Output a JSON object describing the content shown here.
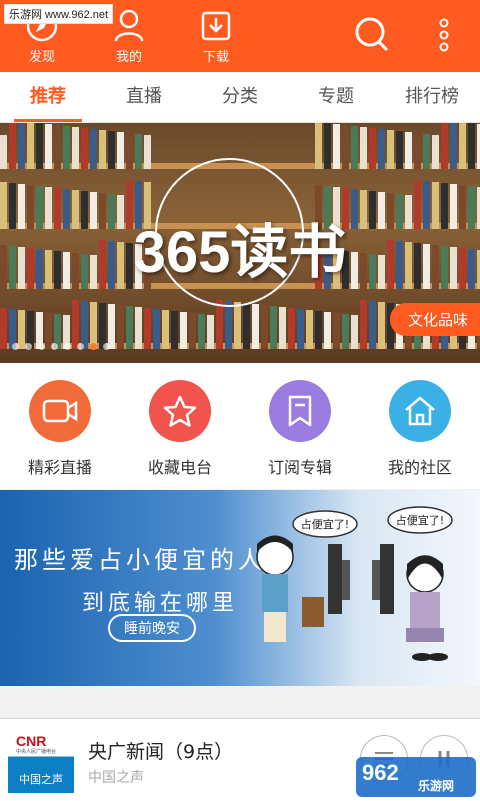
{
  "watermark_top": "乐游网 www.962.net",
  "topbar": {
    "discover_label": "发现",
    "mine_label": "我的",
    "download_label": "下载",
    "icons": [
      "compass-icon",
      "user-icon",
      "download-icon",
      "search-icon",
      "more-vertical-icon"
    ]
  },
  "tabs": [
    {
      "label": "推荐",
      "active": true
    },
    {
      "label": "直播"
    },
    {
      "label": "分类"
    },
    {
      "label": "专题"
    },
    {
      "label": "排行榜"
    }
  ],
  "banner": {
    "title": "365读书",
    "tag": "文化品味",
    "slides": 8,
    "active_slide": 6
  },
  "quick": [
    {
      "label": "精彩直播",
      "color": "#f26b3a",
      "icon": "video-camera-icon"
    },
    {
      "label": "收藏电台",
      "color": "#f0544c",
      "icon": "star-icon"
    },
    {
      "label": "订阅专辑",
      "color": "#9a7be0",
      "icon": "bookmark-icon"
    },
    {
      "label": "我的社区",
      "color": "#3ab0e6",
      "icon": "home-icon"
    }
  ],
  "promo": {
    "line1": "那些爱占小便宜的人，",
    "line2": "到底输在哪里",
    "pill": "睡前晚安",
    "bubble1": "占便宜了!",
    "bubble2": "占便宜了!"
  },
  "player": {
    "cover_logo": "CNR",
    "cover_sub": "中央人民广播电台",
    "cover_channel": "中国之声",
    "title": "央广新闻（9点）",
    "subtitle": "中国之声"
  },
  "watermark_br": {
    "num": "962",
    "site": "乐游网"
  },
  "colors": {
    "accent": "#ff5a1f"
  }
}
